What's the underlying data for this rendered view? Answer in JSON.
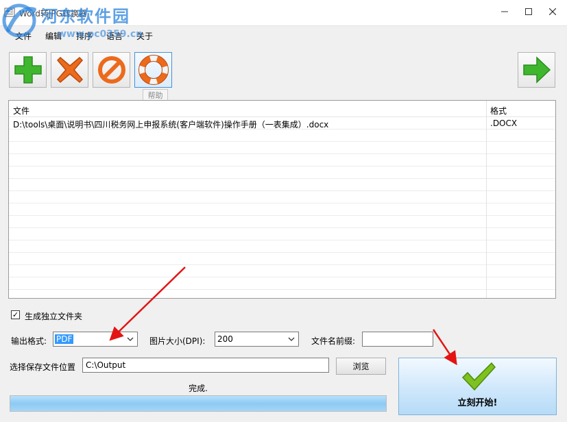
{
  "window": {
    "title": "Word转JPG转换器",
    "icon": "app-icon",
    "controls": {
      "minimize": "minimize-icon",
      "maximize": "maximize-icon",
      "close": "close-icon"
    }
  },
  "watermark": {
    "text": "河东软件园",
    "url": "www.pc0359.cn"
  },
  "menu": [
    "文件",
    "编辑",
    "排序",
    "语言",
    "关于"
  ],
  "toolbar": {
    "buttons": [
      {
        "icon": "plus-icon",
        "color": "#3fb62e"
      },
      {
        "icon": "delete-x-icon",
        "color": "#e8631a"
      },
      {
        "icon": "clear-forbidden-icon",
        "color": "#e8631a"
      },
      {
        "icon": "lifebuoy-icon",
        "color": "#e8631a"
      },
      {
        "icon": "arrow-right-icon",
        "color": "#3fb62e"
      }
    ],
    "tooltip": "帮助"
  },
  "file_list": {
    "columns": {
      "name": "文件",
      "format": "格式"
    },
    "rows": [
      {
        "path": "D:\\tools\\桌面\\说明书\\四川税务网上申报系统(客户端软件)操作手册（一表集成）.docx",
        "format": ".DOCX"
      }
    ]
  },
  "options": {
    "separate_folder_label": "生成独立文件夹",
    "separate_folder_checked": "✓",
    "output_format_label": "输出格式:",
    "output_format_value": "PDF",
    "image_size_label": "图片大小(DPI):",
    "image_size_value": "200",
    "prefix_label": "文件名前缀:",
    "prefix_value": "",
    "save_location_label": "选择保存文件位置",
    "save_location_value": "C:\\Output",
    "browse_label": "浏览"
  },
  "status": {
    "text": "完成.",
    "progress": 1.0
  },
  "start_button": {
    "label": "立刻开始!",
    "icon": "checkmark-icon",
    "accent": "#7dc21e"
  },
  "colors": {
    "accent_blue": "#3399ff",
    "annotation_red": "#e31414"
  }
}
